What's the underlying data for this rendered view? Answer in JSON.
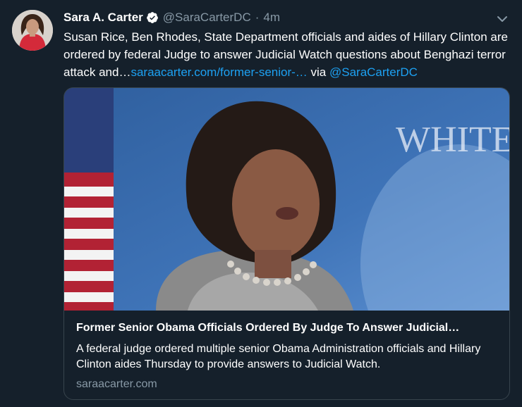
{
  "tweet": {
    "name": "Sara A. Carter",
    "handle": "@SaraCarterDC",
    "separator": "·",
    "time": "4m",
    "text_main": "Susan Rice, Ben Rhodes, State Department officials and aides of Hillary Clinton are ordered by federal Judge to answer Judicial Watch questions about Benghazi terror attack and…",
    "link_text": "saraacarter.com/former-senior-…",
    "via_text": " via ",
    "mention": "@SaraCarterDC"
  },
  "card": {
    "image_text": "WHITE H",
    "title": "Former Senior Obama Officials Ordered By Judge To Answer Judicial…",
    "description": "A federal judge ordered multiple senior Obama Administration officials and Hillary Clinton aides Thursday to provide answers to Judicial Watch.",
    "domain": "saraacarter.com"
  },
  "colors": {
    "background": "#15202b",
    "text": "#ffffff",
    "secondary": "#8899a6",
    "link": "#1da1f2",
    "border": "#38444d"
  },
  "icons": {
    "verified": "verified-badge-icon",
    "menu": "chevron-down-icon"
  }
}
